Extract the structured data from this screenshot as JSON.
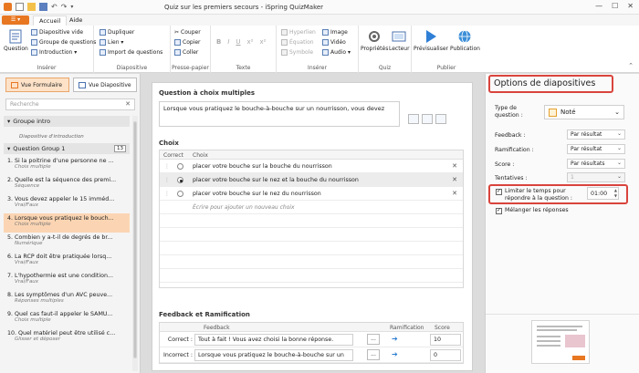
{
  "titlebar": {
    "title": "Quiz sur les premiers secours - iSpring QuizMaker"
  },
  "tabs": {
    "file_label": "☰ ▾",
    "items": [
      "Accueil",
      "Aide"
    ],
    "active": "Accueil"
  },
  "ribbon": {
    "question_btn": "Question",
    "insert_items": [
      "Diapositive vide",
      "Groupe de questions",
      "Introduction ▾"
    ],
    "insert_label": "Insérer",
    "slide_items": [
      "Dupliquer",
      "Lien ▾",
      "Import de questions"
    ],
    "slide_label": "Diapositive",
    "clip_items": [
      "Couper",
      "Copier",
      "Coller"
    ],
    "clip_label": "Presse-papier",
    "text_items": [
      "B",
      "I",
      "U",
      "x²",
      "x²"
    ],
    "text_label": "Texte",
    "ins2_items": [
      "Hyperlien",
      "Équation",
      "Symbole"
    ],
    "ins2_items_b": [
      "Image",
      "Vidéo",
      "Audio ▾"
    ],
    "ins2_label": "Insérer",
    "quiz_items": [
      "Propriétés",
      "Lecteur"
    ],
    "quiz_label": "Quiz",
    "pub_items": [
      "Prévisualiser",
      "Publication"
    ],
    "pub_label": "Publier"
  },
  "sidebar": {
    "view_form": "Vue Formulaire",
    "view_slide": "Vue Diapositive",
    "search_placeholder": "Recherche",
    "search_clear": "✕",
    "group_intro": "Groupe intro",
    "intro_slide": "Diapositive d'introduction",
    "question_group": "Question Group 1",
    "group_count": "13",
    "items": [
      {
        "title": "1. Si la poitrine d'une personne ne ...",
        "sub": "Choix multiple"
      },
      {
        "title": "2. Quelle est la séquence des premi...",
        "sub": "Séquence"
      },
      {
        "title": "3. Vous devez appeler le 15 imméd...",
        "sub": "Vrai/Faux"
      },
      {
        "title": "4. Lorsque vous pratiquez le bouch...",
        "sub": "Choix multiple"
      },
      {
        "title": "5. Combien y a-t-il de degrés de br...",
        "sub": "Numérique"
      },
      {
        "title": "6. La RCP doit être pratiquée lorsq...",
        "sub": "Vrai/Faux"
      },
      {
        "title": "7. L'hypothermie est une condition...",
        "sub": "Vrai/Faux"
      },
      {
        "title": "8. Les symptômes d'un AVC peuve...",
        "sub": "Réponses multiples"
      },
      {
        "title": "9. Quel cas faut-il appeler le SAMU...",
        "sub": "Choix multiple"
      },
      {
        "title": "10. Quel matériel peut être utilisé c...",
        "sub": "Glisser et déposer"
      }
    ],
    "selected_index": 3
  },
  "main": {
    "question_title": "Question à choix multiples",
    "question_text": "Lorsque vous pratiquez le bouche-à-bouche sur un nourrisson, vous devez",
    "choices_title": "Choix",
    "col_correct": "Correct",
    "col_choice": "Choix",
    "choices": [
      {
        "text": "placer votre bouche sur la bouche du nourrisson",
        "correct": false
      },
      {
        "text": "placer votre bouche sur le nez et la bouche du nourrisson",
        "correct": true
      },
      {
        "text": "placer votre bouche sur le nez du nourrisson",
        "correct": false
      }
    ],
    "add_choice": "Écrire pour ajouter un nouveau choix",
    "feedback_title": "Feedback et Ramification",
    "col_feedback": "Feedback",
    "col_branch": "Ramification",
    "col_score": "Score",
    "feedback": [
      {
        "label": "Correct :",
        "text": "Tout à fait ! Vous avez choisi la bonne réponse.",
        "score": "10"
      },
      {
        "label": "Incorrect :",
        "text": "Lorsque vous pratiquez le bouche-à-bouche sur un",
        "score": "0"
      }
    ],
    "more_label": "...",
    "branch_arrow": "➔"
  },
  "options": {
    "title": "Options de diapositives",
    "type_label": "Type de question :",
    "type_value": "Noté",
    "feedback_label": "Feedback :",
    "feedback_value": "Par résultat",
    "branch_label": "Ramification :",
    "branch_value": "Par résultat",
    "score_label": "Score :",
    "score_value": "Par résultats",
    "attempts_label": "Tentatives :",
    "attempts_value": "1",
    "limit_label": "Limiter le temps pour répondre à la question :",
    "limit_checked": true,
    "time_value": "01:00",
    "shuffle_label": "Mélanger les réponses",
    "shuffle_checked": true
  },
  "colors": {
    "accent": "#e87722",
    "highlight": "#d9443d",
    "selection": "#fbd5b3"
  }
}
